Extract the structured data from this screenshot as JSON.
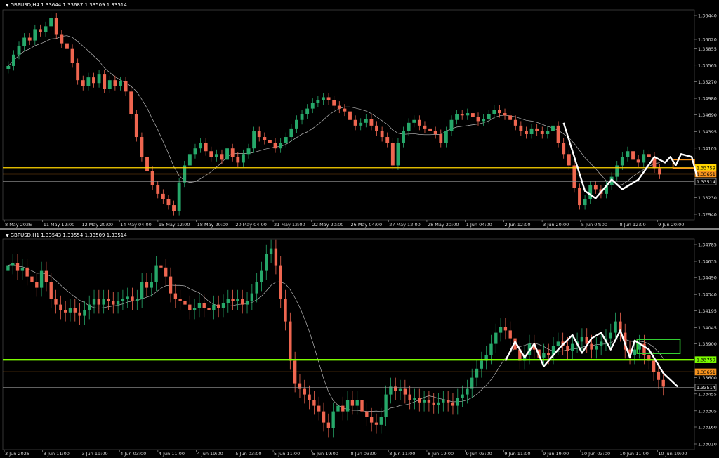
{
  "charts": [
    {
      "header": {
        "symbol": "GBPUSD,H4",
        "ohlc": "1.33644 1.33687 1.33509 1.33514"
      },
      "colors": {
        "bull": "#26a86a",
        "bear": "#ef6650",
        "ma": "#d8d8d8",
        "pattern": "#ffffff",
        "yellow": "#ffd400",
        "orange": "#f7931e",
        "box": "#f7931e",
        "current": "#9a9a9a"
      },
      "chart_data": {
        "type": "candlestick",
        "ylim": [
          1.3294,
          1.3644
        ],
        "yticks": [
          "1.36440",
          "1.36020",
          "1.35855",
          "1.35565",
          "1.35270",
          "1.34980",
          "1.34690",
          "1.34395",
          "1.34105",
          "1.33759",
          "1.33651",
          "1.33514",
          "1.33230",
          "1.32940"
        ],
        "ytick_values": [
          1.3644,
          1.3602,
          1.35855,
          1.35565,
          1.3527,
          1.3498,
          1.3469,
          1.34395,
          1.34105,
          1.33759,
          1.33651,
          1.33514,
          1.3323,
          1.3294
        ],
        "yticks_plain": [
          1.3644,
          1.3602,
          1.35855,
          1.35565,
          1.3527,
          1.3498,
          1.3469,
          1.34395,
          1.34105,
          1.3323,
          1.3294
        ],
        "xlabels": [
          "8 May 2026",
          "11 May 12:00",
          "12 May 20:00",
          "14 May 04:00",
          "15 May 12:00",
          "18 May 20:00",
          "20 May 04:00",
          "21 May 12:00",
          "22 May 20:00",
          "26 May 04:00",
          "27 May 12:00",
          "28 May 20:00",
          "1 Jun 04:00",
          "2 Jun 12:00",
          "3 Jun 20:00",
          "5 Jun 04:00",
          "8 Jun 12:00",
          "9 Jun 20:00"
        ],
        "closes": [
          1.3555,
          1.3575,
          1.359,
          1.3605,
          1.36,
          1.362,
          1.3615,
          1.3625,
          1.364,
          1.361,
          1.3595,
          1.3585,
          1.356,
          1.353,
          1.352,
          1.3535,
          1.3525,
          1.354,
          1.3515,
          1.353,
          1.352,
          1.3528,
          1.351,
          1.347,
          1.343,
          1.3395,
          1.337,
          1.3345,
          1.333,
          1.332,
          1.331,
          1.33,
          1.335,
          1.338,
          1.34,
          1.341,
          1.342,
          1.3405,
          1.3395,
          1.34,
          1.339,
          1.341,
          1.3395,
          1.3385,
          1.34,
          1.341,
          1.344,
          1.343,
          1.3425,
          1.342,
          1.341,
          1.342,
          1.343,
          1.3445,
          1.346,
          1.347,
          1.348,
          1.349,
          1.3495,
          1.35,
          1.3495,
          1.3485,
          1.348,
          1.3475,
          1.346,
          1.345,
          1.3455,
          1.3462,
          1.345,
          1.344,
          1.343,
          1.342,
          1.338,
          1.342,
          1.344,
          1.3455,
          1.346,
          1.345,
          1.3445,
          1.344,
          1.3435,
          1.342,
          1.344,
          1.346,
          1.347,
          1.3468,
          1.3472,
          1.3465,
          1.3458,
          1.3462,
          1.347,
          1.3478,
          1.3472,
          1.3468,
          1.346,
          1.345,
          1.344,
          1.3435,
          1.3445,
          1.344,
          1.3435,
          1.344,
          1.345,
          1.342,
          1.34,
          1.338,
          1.334,
          1.331,
          1.332,
          1.3345,
          1.3338,
          1.333,
          1.3345,
          1.336,
          1.338,
          1.3395,
          1.3405,
          1.339,
          1.3385,
          1.34,
          1.3395,
          1.3375,
          1.3364
        ],
        "moving_average_label": "",
        "levels": [
          {
            "value": 1.33759,
            "label": "1.33759",
            "color": "yellow"
          },
          {
            "value": 1.33651,
            "label": "1.33651",
            "color": "orange"
          },
          {
            "value": 1.33514,
            "label": "1.33514",
            "color": "current"
          }
        ],
        "zone_box": {
          "x_start_index": 124.5,
          "x_end_index": 128.5,
          "y_top": 1.339,
          "y_bottom": 1.3375
        },
        "pattern_path": [
          [
            104,
            1.3455
          ],
          [
            108,
            1.3335
          ],
          [
            110,
            1.3322
          ],
          [
            113,
            1.3355
          ],
          [
            115,
            1.3338
          ],
          [
            118,
            1.3355
          ],
          [
            121,
            1.3395
          ],
          [
            123,
            1.3385
          ],
          [
            124,
            1.3395
          ],
          [
            125,
            1.338
          ],
          [
            126,
            1.34
          ],
          [
            128,
            1.3395
          ],
          [
            129,
            1.336
          ]
        ]
      }
    },
    {
      "header": {
        "symbol": "GBPUSD,H1",
        "ohlc": "1.33543 1.33554 1.33509 1.33514"
      },
      "colors": {
        "bull": "#26a86a",
        "bear": "#ef6650",
        "ma": "#d8d8d8",
        "pattern": "#ffffff",
        "green": "#7cfc00",
        "orange": "#f7931e",
        "box": "#32cd32",
        "current": "#9a9a9a"
      },
      "chart_data": {
        "type": "candlestick",
        "ylim": [
          1.3301,
          1.34785
        ],
        "yticks": [
          "1.34785",
          "1.34635",
          "1.34490",
          "1.34340",
          "1.34195",
          "1.34045",
          "1.33900",
          "1.33759",
          "1.33651",
          "1.33600",
          "1.33514",
          "1.33455",
          "1.33305",
          "1.33160",
          "1.33010"
        ],
        "ytick_values": [
          1.34785,
          1.34635,
          1.3449,
          1.3434,
          1.34195,
          1.34045,
          1.339,
          1.33759,
          1.33651,
          1.336,
          1.33514,
          1.33455,
          1.33305,
          1.3316,
          1.3301
        ],
        "yticks_plain": [
          1.34785,
          1.34635,
          1.3449,
          1.3434,
          1.34195,
          1.34045,
          1.339,
          1.336,
          1.33455,
          1.33305,
          1.3316,
          1.3301
        ],
        "xlabels": [
          "3 Jun 2026",
          "3 Jun 11:00",
          "3 Jun 19:00",
          "4 Jun 03:00",
          "4 Jun 11:00",
          "4 Jun 19:00",
          "5 Jun 03:00",
          "5 Jun 11:00",
          "5 Jun 19:00",
          "8 Jun 03:00",
          "8 Jun 11:00",
          "8 Jun 19:00",
          "9 Jun 03:00",
          "9 Jun 11:00",
          "9 Jun 19:00",
          "10 Jun 03:00",
          "10 Jun 11:00",
          "10 Jun 19:00"
        ],
        "closes": [
          1.346,
          1.3462,
          1.3455,
          1.3458,
          1.345,
          1.3445,
          1.344,
          1.3455,
          1.3445,
          1.343,
          1.3425,
          1.342,
          1.3418,
          1.3422,
          1.3418,
          1.3415,
          1.342,
          1.3425,
          1.343,
          1.3425,
          1.343,
          1.3428,
          1.3425,
          1.3428,
          1.343,
          1.3432,
          1.3428,
          1.343,
          1.3445,
          1.344,
          1.3445,
          1.346,
          1.3458,
          1.345,
          1.3435,
          1.343,
          1.3428,
          1.3425,
          1.342,
          1.3422,
          1.3426,
          1.3422,
          1.342,
          1.3425,
          1.3422,
          1.3426,
          1.343,
          1.3428,
          1.343,
          1.3425,
          1.3428,
          1.3435,
          1.3445,
          1.3455,
          1.347,
          1.3475,
          1.346,
          1.343,
          1.341,
          1.3375,
          1.3355,
          1.335,
          1.3345,
          1.334,
          1.3335,
          1.333,
          1.332,
          1.3315,
          1.333,
          1.3335,
          1.333,
          1.334,
          1.3335,
          1.334,
          1.333,
          1.3325,
          1.332,
          1.3318,
          1.3325,
          1.3345,
          1.3352,
          1.3348,
          1.335,
          1.3345,
          1.334,
          1.3342,
          1.3338,
          1.334,
          1.3338,
          1.3336,
          1.3338,
          1.334,
          1.3338,
          1.3335,
          1.3342,
          1.3345,
          1.335,
          1.336,
          1.3368,
          1.3375,
          1.338,
          1.339,
          1.34,
          1.3405,
          1.3402,
          1.3395,
          1.3385,
          1.3375,
          1.338,
          1.339,
          1.3385,
          1.3378,
          1.3382,
          1.338,
          1.3388,
          1.3392,
          1.3388,
          1.3384,
          1.339,
          1.3392,
          1.3396,
          1.339,
          1.3385,
          1.3388,
          1.3392,
          1.3395,
          1.34,
          1.341,
          1.34,
          1.3385,
          1.338,
          1.3385,
          1.339,
          1.338,
          1.3375,
          1.3365,
          1.3358,
          1.3352
        ],
        "moving_average_label": "",
        "levels": [
          {
            "value": 1.33759,
            "label": "1.33759",
            "color": "green"
          },
          {
            "value": 1.33651,
            "label": "1.33651",
            "color": "orange"
          },
          {
            "value": 1.33514,
            "label": "1.33514",
            "color": "current"
          }
        ],
        "zone_box": {
          "x_start_index": 131.5,
          "x_end_index": 140.5,
          "y_top": 1.3394,
          "y_bottom": 1.33815
        },
        "pattern_path": [
          [
            104,
            1.3375
          ],
          [
            106,
            1.3392
          ],
          [
            108,
            1.3378
          ],
          [
            110,
            1.339
          ],
          [
            112,
            1.337
          ],
          [
            115,
            1.3385
          ],
          [
            118,
            1.3398
          ],
          [
            120,
            1.3382
          ],
          [
            122,
            1.3395
          ],
          [
            124,
            1.34
          ],
          [
            126,
            1.3385
          ],
          [
            128,
            1.3402
          ],
          [
            130,
            1.3378
          ],
          [
            131,
            1.3393
          ],
          [
            134,
            1.3385
          ],
          [
            137,
            1.3364
          ],
          [
            140,
            1.3352
          ]
        ]
      }
    }
  ]
}
